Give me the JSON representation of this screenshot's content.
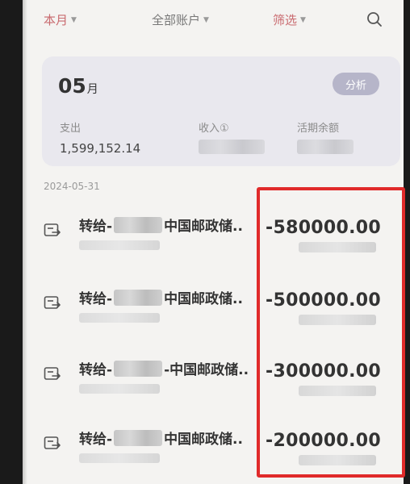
{
  "filters": {
    "month": "本月",
    "account": "全部账户",
    "screen": "筛选"
  },
  "icons": {
    "search": "search-icon",
    "transfer": "transfer-icon"
  },
  "summary": {
    "month_number": "05",
    "month_unit": "月",
    "analyze_label": "分析",
    "expense_label": "支出",
    "expense_value": "1,599,152.14",
    "income_label": "收入①",
    "balance_label": "活期余额"
  },
  "date": "2024-05-31",
  "transactions": [
    {
      "prefix": "转给-",
      "bank": "中国邮政储..",
      "amount": "-580000.00"
    },
    {
      "prefix": "转给-",
      "bank": "中国邮政储..",
      "amount": "-500000.00"
    },
    {
      "prefix": "转给-",
      "bank": "-中国邮政储..",
      "amount": "-300000.00"
    },
    {
      "prefix": "转给-",
      "bank": "中国邮政储..",
      "amount": "-200000.00"
    }
  ],
  "colors": {
    "accent": "#c96a6f",
    "highlight": "#e02a2a",
    "card": "#e9e8ee"
  }
}
